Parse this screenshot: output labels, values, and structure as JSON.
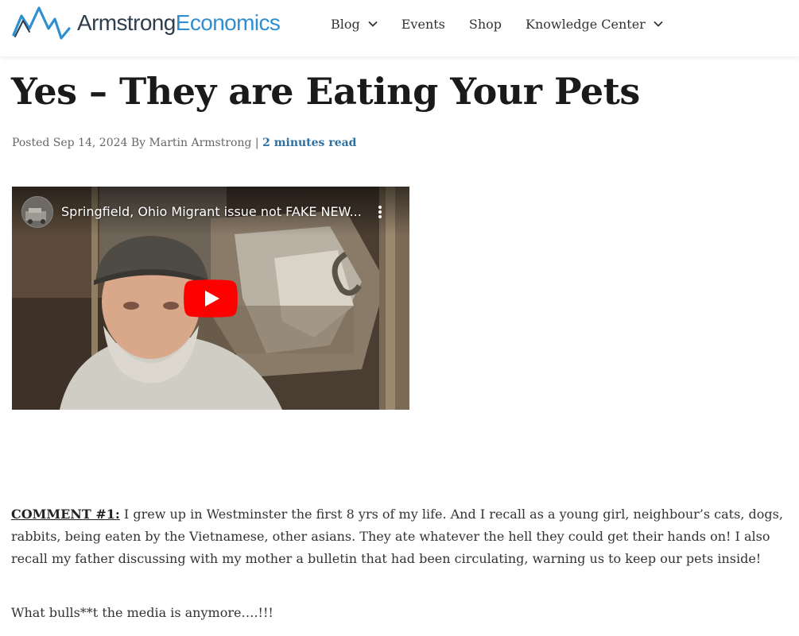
{
  "header": {
    "logo": {
      "word1": "Armstrong",
      "word2": "Economics",
      "colors": {
        "dark": "#2f3e4e",
        "accent": "#2f8fd0"
      }
    },
    "nav": [
      {
        "label": "Blog",
        "has_dropdown": true
      },
      {
        "label": "Events",
        "has_dropdown": false
      },
      {
        "label": "Shop",
        "has_dropdown": false
      },
      {
        "label": "Knowledge Center",
        "has_dropdown": true
      }
    ]
  },
  "article": {
    "title": "Yes – They are Eating Your Pets",
    "meta": {
      "prefix": "Posted Sep 14, 2024 By Martin Armstrong",
      "separator": " | ",
      "read_time": "2 minutes read"
    }
  },
  "video": {
    "title": "Springfield, Ohio Migrant issue not FAKE NEW...",
    "icons": {
      "menu": "more-vert-icon",
      "play": "youtube-play-icon"
    }
  },
  "comment": {
    "label": "COMMENT #1:",
    "text": " I grew up in Westminster the first 8 yrs of my life. And I recall as a young girl, neighbour’s cats, dogs, rabbits, being eaten by the Vietnamese, other asians. They ate whatever the hell they could get their hands on! I also recall my father discussing with my mother a bulletin that had been circulating, warning us to keep our pets inside!",
    "closing": "What bulls**t the media is anymore….!!!"
  }
}
